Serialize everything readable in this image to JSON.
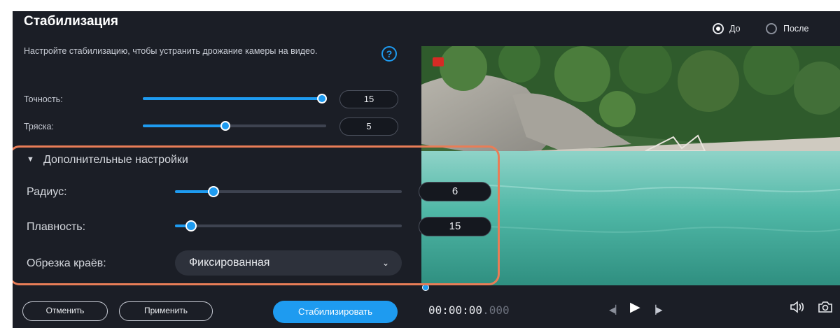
{
  "dialog": {
    "title": "Стабилизация",
    "description": "Настройте стабилизацию, чтобы устранить дрожание камеры на видео.",
    "help_icon": "?"
  },
  "view_toggle": {
    "before_label": "До",
    "after_label": "После",
    "selected": "До"
  },
  "sliders": {
    "accuracy": {
      "label": "Точность:",
      "value": "15",
      "fraction": 1.0
    },
    "shake": {
      "label": "Тряска:",
      "value": "5",
      "fraction": 0.45
    }
  },
  "advanced": {
    "title": "Дополнительные настройки",
    "expanded": true,
    "radius": {
      "label": "Радиус:",
      "value": "6",
      "fraction": 0.17
    },
    "smoothness": {
      "label": "Плавность:",
      "value": "15",
      "fraction": 0.07
    },
    "crop": {
      "label": "Обрезка краёв:",
      "selected": "Фиксированная"
    }
  },
  "buttons": {
    "cancel": "Отменить",
    "apply": "Применить",
    "stabilize": "Стабилизировать"
  },
  "player": {
    "time_main": "00:00:00",
    "time_ms": ".000"
  },
  "icons": {
    "help": "question-circle-icon",
    "expand": "chevron-down-icon",
    "dropdown": "chevron-down-icon",
    "prev": "previous-frame-icon",
    "play": "play-icon",
    "next": "next-frame-icon",
    "volume": "volume-icon",
    "snapshot": "camera-icon"
  },
  "colors": {
    "accent": "#1e9bf0",
    "panel_bg": "#1b1e26",
    "highlight_border": "#e87d57"
  }
}
